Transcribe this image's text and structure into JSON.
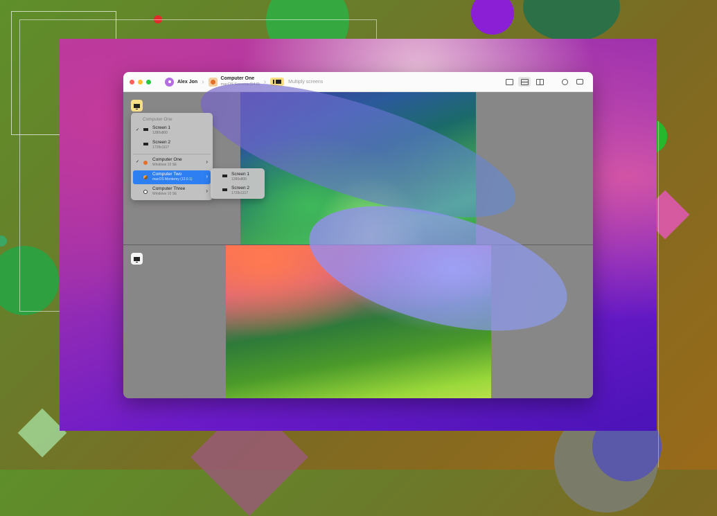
{
  "window": {
    "user_name": "Alex Jon",
    "computer_title": "Computer One",
    "computer_subtitle": "macOS Sonoma (14.0)",
    "mode_label": "Multiply screens"
  },
  "toolbar": {
    "buttons": [
      "single-view-icon",
      "split-horizontal-icon",
      "split-vertical-icon",
      "settings-icon",
      "chat-icon"
    ]
  },
  "menu": {
    "header": "Computer One",
    "screens": [
      {
        "title": "Screen 1",
        "subtitle": "1280x800",
        "checked": true
      },
      {
        "title": "Screen 2",
        "subtitle": "1728x1117",
        "checked": false
      }
    ],
    "computers": [
      {
        "title": "Computer One",
        "subtitle": "Windows 10 SE",
        "checked": true,
        "selected": false
      },
      {
        "title": "Computer Two",
        "subtitle": "macOS Monterey (12.0.1)",
        "checked": false,
        "selected": true
      },
      {
        "title": "Computer Three",
        "subtitle": "Windows 10 SE",
        "checked": false,
        "selected": false
      }
    ]
  },
  "submenu": {
    "items": [
      {
        "title": "Screen 1",
        "subtitle": "1280x800"
      },
      {
        "title": "Screen 2",
        "subtitle": "1728x1117"
      }
    ]
  },
  "colors": {
    "accent": "#2d7ff2",
    "selector_active": "#f8df8a"
  }
}
